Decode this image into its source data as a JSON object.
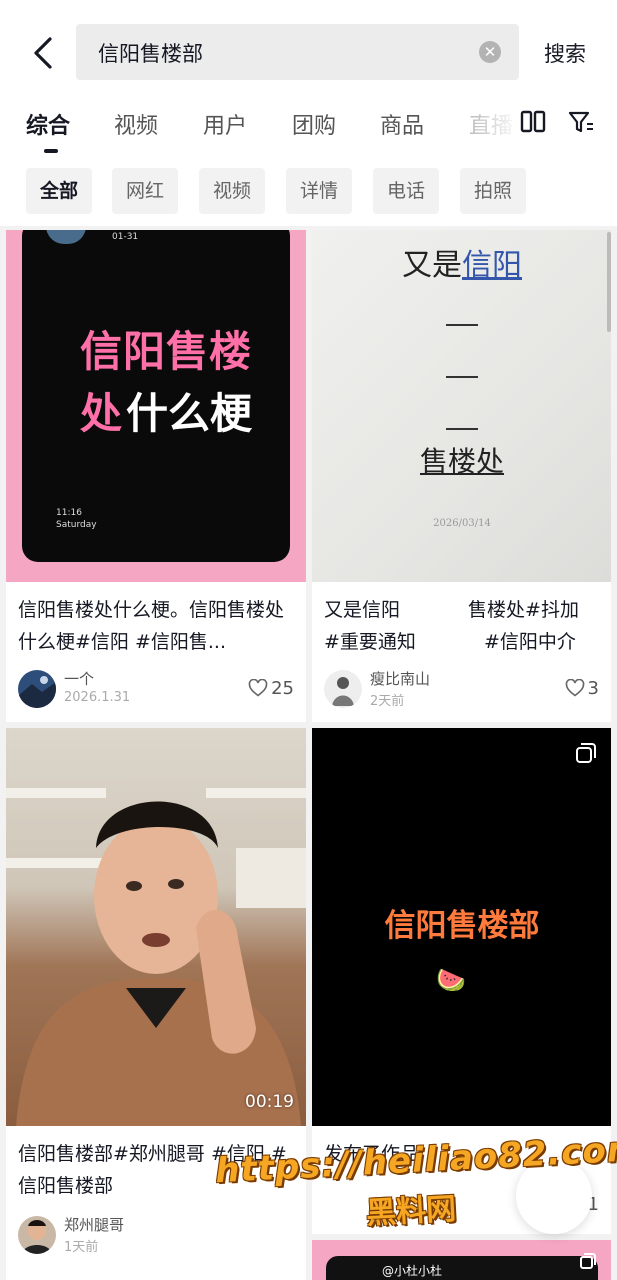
{
  "header": {
    "search_query": "信阳售楼部",
    "search_button": "搜索"
  },
  "tabs": [
    "综合",
    "视频",
    "用户",
    "团购",
    "商品",
    "直播"
  ],
  "filters": [
    "全部",
    "网红",
    "视频",
    "详情",
    "电话",
    "拍照"
  ],
  "results": [
    {
      "thumb": {
        "line1": "信阳售楼",
        "line2a": "处",
        "line2b": "什么梗",
        "date_small": "01-31",
        "time_small": "11:16",
        "day_small": "Saturday"
      },
      "title": "信阳售楼处什么梗。信阳售楼处什么梗#信阳 #信阳售...",
      "author": "一个",
      "date": "2026.1.31",
      "likes": "25"
    },
    {
      "thumb": {
        "heading_a": "又是",
        "heading_b": "信阳",
        "bottom": "售楼处",
        "date_small": "2026/03/14"
      },
      "title": "又是信阳 售楼处#抖加 #重要通知 #信阳中介",
      "author": "瘦比南山",
      "date": "2天前",
      "likes": "3"
    },
    {
      "thumb": {
        "duration": "00:19"
      },
      "title": "信阳售楼部#郑州腿哥 #信阳 #信阳售楼部",
      "author": "郑州腿哥",
      "date": "1天前",
      "likes": ""
    },
    {
      "thumb": {
        "text": "信阳售楼部",
        "emoji": "🍉"
      },
      "title": "发布了作品",
      "author": "",
      "date": "",
      "likes": "1"
    },
    {
      "thumb": {
        "tag": "@小杜小杜"
      }
    }
  ],
  "watermark": {
    "url": "https://heiliao82.com",
    "text": "黑料网"
  },
  "colors": {
    "pink": "#f4a6c3",
    "orange_text": "#ff7a3d",
    "pink_text": "#ff6fa8",
    "link_blue": "#3355aa"
  }
}
